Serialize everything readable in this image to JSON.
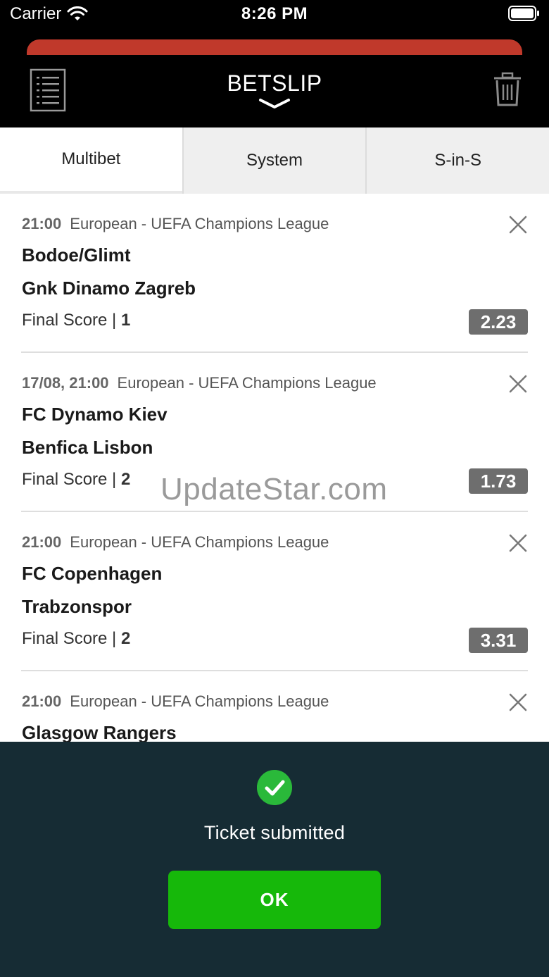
{
  "status_bar": {
    "carrier": "Carrier",
    "time": "8:26 PM"
  },
  "header": {
    "title": "BETSLIP",
    "icons": [
      "list-icon",
      "chevron-down-icon",
      "trash-icon"
    ]
  },
  "tabs": [
    {
      "label": "Multibet",
      "active": true
    },
    {
      "label": "System",
      "active": false
    },
    {
      "label": "S-in-S",
      "active": false
    }
  ],
  "bets": [
    {
      "time": "21:00",
      "league": "European - UEFA Champions League",
      "team1": "Bodoe/Glimt",
      "team2": "Gnk Dinamo Zagreb",
      "market": "Final Score |",
      "pick": "1",
      "odds": "2.23"
    },
    {
      "time": "17/08, 21:00",
      "league": "European - UEFA Champions League",
      "team1": "FC Dynamo Kiev",
      "team2": "Benfica Lisbon",
      "market": "Final Score |",
      "pick": "2",
      "odds": "1.73"
    },
    {
      "time": "21:00",
      "league": "European - UEFA Champions League",
      "team1": "FC Copenhagen",
      "team2": "Trabzonspor",
      "market": "Final Score |",
      "pick": "2",
      "odds": "3.31"
    },
    {
      "time": "21:00",
      "league": "European - UEFA Champions League",
      "team1": "Glasgow Rangers",
      "team2": "",
      "market": "",
      "pick": "",
      "odds": ""
    }
  ],
  "watermark": "UpdateStar.com",
  "confirmation": {
    "message": "Ticket submitted",
    "ok_label": "OK",
    "icon": "check-circle-icon"
  },
  "colors": {
    "header_bg": "#000000",
    "accent_red": "#c0392b",
    "panel_bg": "#162c34",
    "ok_green": "#16b80a",
    "odds_bg": "#6e6e6e"
  }
}
